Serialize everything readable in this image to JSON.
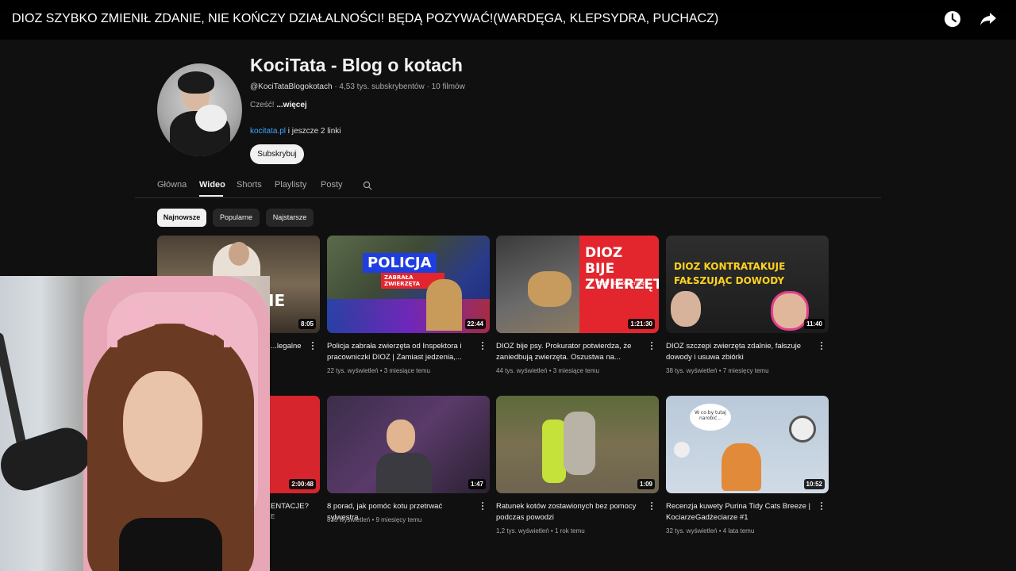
{
  "video_title": "DIOZ SZYBKO ZMIENIŁ ZDANIE, NIE KOŃCZY DZIAŁALNOŚCI! BĘDĄ POZYWAĆ!(WARDĘGA, KLEPSYDRA, PUCHACZ)",
  "top_icons": {
    "watch_later": "clock-icon",
    "share": "share-arrow-icon"
  },
  "channel": {
    "name": "KociTata - Blog o kotach",
    "handle": "@KociTataBlogokotach",
    "stats": " · 4,53 tys. subskrybentów · 10 filmów",
    "description": "Cześć! ",
    "more": "...więcej",
    "link": "kocitata.pl",
    "links_more": " i jeszcze 2 linki",
    "subscribe": "Subskrybuj"
  },
  "tabs": [
    "Główna",
    "Wideo",
    "Shorts",
    "Playlisty",
    "Posty"
  ],
  "active_tab": "Wideo",
  "chips": [
    "Najnowsze",
    "Popularne",
    "Najstarsze"
  ],
  "videos_row1": [
    {
      "duration": "8:05",
      "title": "...legalne",
      "meta": ""
    },
    {
      "duration": "22:44",
      "title": "Policja zabrała zwierzęta od Inspektora i pracowniczki DIOZ | Zamiast jedzenia,...",
      "meta": "22 tys. wyświetleń • 3 miesiące temu",
      "thumb_text": "POLICJA",
      "thumb_sub": "ZABRAŁA ZWIERZĘTA"
    },
    {
      "duration": "1:21:30",
      "title": "DIOZ bije psy. Prokurator potwierdza, że zaniedbują zwierzęta. Oszustwa na...",
      "meta": "44 tys. wyświetleń • 3 miesiące temu",
      "thumb_text": "DIOZ BIJE ZWIERZĘTA",
      "thumb_sub": "Fani to popierają"
    },
    {
      "duration": "11:40",
      "title": "DIOZ szczepi zwierzęta zdalnie, fałszuje dowody i usuwa zbiórki",
      "meta": "38 tys. wyświetleń • 7 miesięcy temu",
      "thumb_text": "DIOZ KONTRATAKUJE FAŁSZUJĄC DOWODY"
    }
  ],
  "videos_row2": [
    {
      "duration": "2:00:48",
      "title": "ENTACJE?",
      "meta": "E"
    },
    {
      "duration": "1:47",
      "title": "8 porad, jak pomóc kotu przetrwać sylwestra",
      "meta": "836 wyświetleń • 9 miesięcy temu"
    },
    {
      "duration": "1:09",
      "title": "Ratunek kotów zostawionych bez pomocy podczas powodzi",
      "meta": "1,2 tys. wyświetleń • 1 rok temu"
    },
    {
      "duration": "10:52",
      "title": "Recenzja kuwety Purina Tidy Cats Breeze | KociarzeGadżeciarze #1",
      "meta": "32 tys. wyświetleń • 4 lata temu",
      "thumb_bubble": "W co by tutaj narobić..."
    }
  ],
  "colors": {
    "accent_red": "#e3262e",
    "link_blue": "#3ea6ff",
    "background": "#101010"
  }
}
